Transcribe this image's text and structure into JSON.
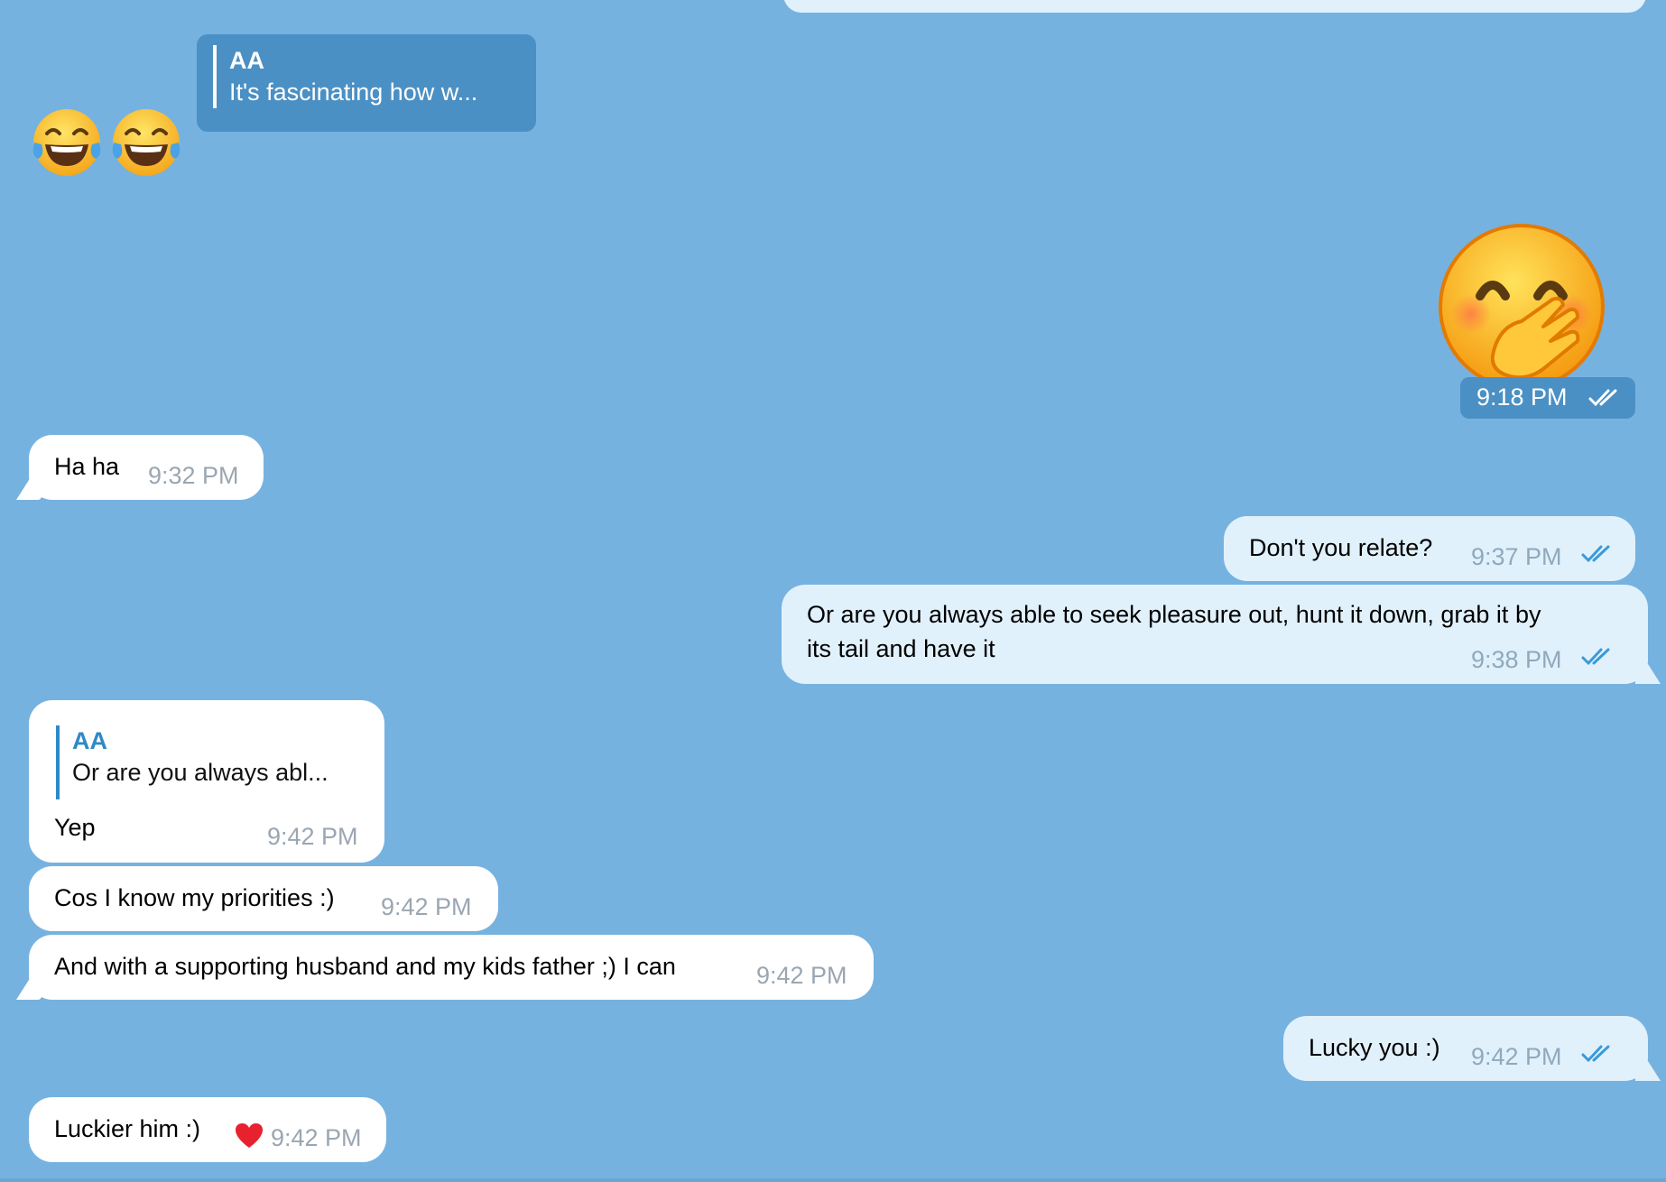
{
  "theme": {
    "background": "#76b2e0",
    "incoming_bubble": "#ffffff",
    "outgoing_bubble": "#e1f1fc",
    "accent": "#2f89c6",
    "time_color": "#9aa6b2",
    "pill_color": "#4b90c4"
  },
  "reply_card": {
    "name": "AA",
    "text": "It's fascinating how w..."
  },
  "emojis": {
    "laughing_pair": [
      "face-with-tears-of-joy-icon",
      "face-with-tears-of-joy-icon"
    ],
    "sticker": "face-with-hand-over-mouth-icon",
    "sticker_time": "9:18 PM"
  },
  "messages": [
    {
      "id": "m1",
      "dir": "in",
      "text": "Ha ha",
      "time": "9:32 PM"
    },
    {
      "id": "m2",
      "dir": "out",
      "text": "Don't you relate?",
      "time": "9:37 PM",
      "read": true
    },
    {
      "id": "m3",
      "dir": "out",
      "text_line1": "Or are you always able to seek pleasure out, hunt it down, grab it by",
      "text_line2": "its tail and have it",
      "time": "9:38 PM",
      "read": true
    },
    {
      "id": "m4",
      "dir": "in",
      "reply_name": "AA",
      "reply_text": "Or are you always abl...",
      "text": "Yep",
      "time": "9:42 PM"
    },
    {
      "id": "m5",
      "dir": "in",
      "text": "Cos I know my priorities :)",
      "time": "9:42 PM"
    },
    {
      "id": "m6",
      "dir": "in",
      "text": "And with a supporting husband and my kids father ;) I can",
      "time": "9:42 PM"
    },
    {
      "id": "m7",
      "dir": "out",
      "text": "Lucky you :)",
      "time": "9:42 PM",
      "read": true
    },
    {
      "id": "m8",
      "dir": "in",
      "text": "Luckier him :)",
      "time": "9:42 PM",
      "reaction": "heart-icon"
    }
  ]
}
